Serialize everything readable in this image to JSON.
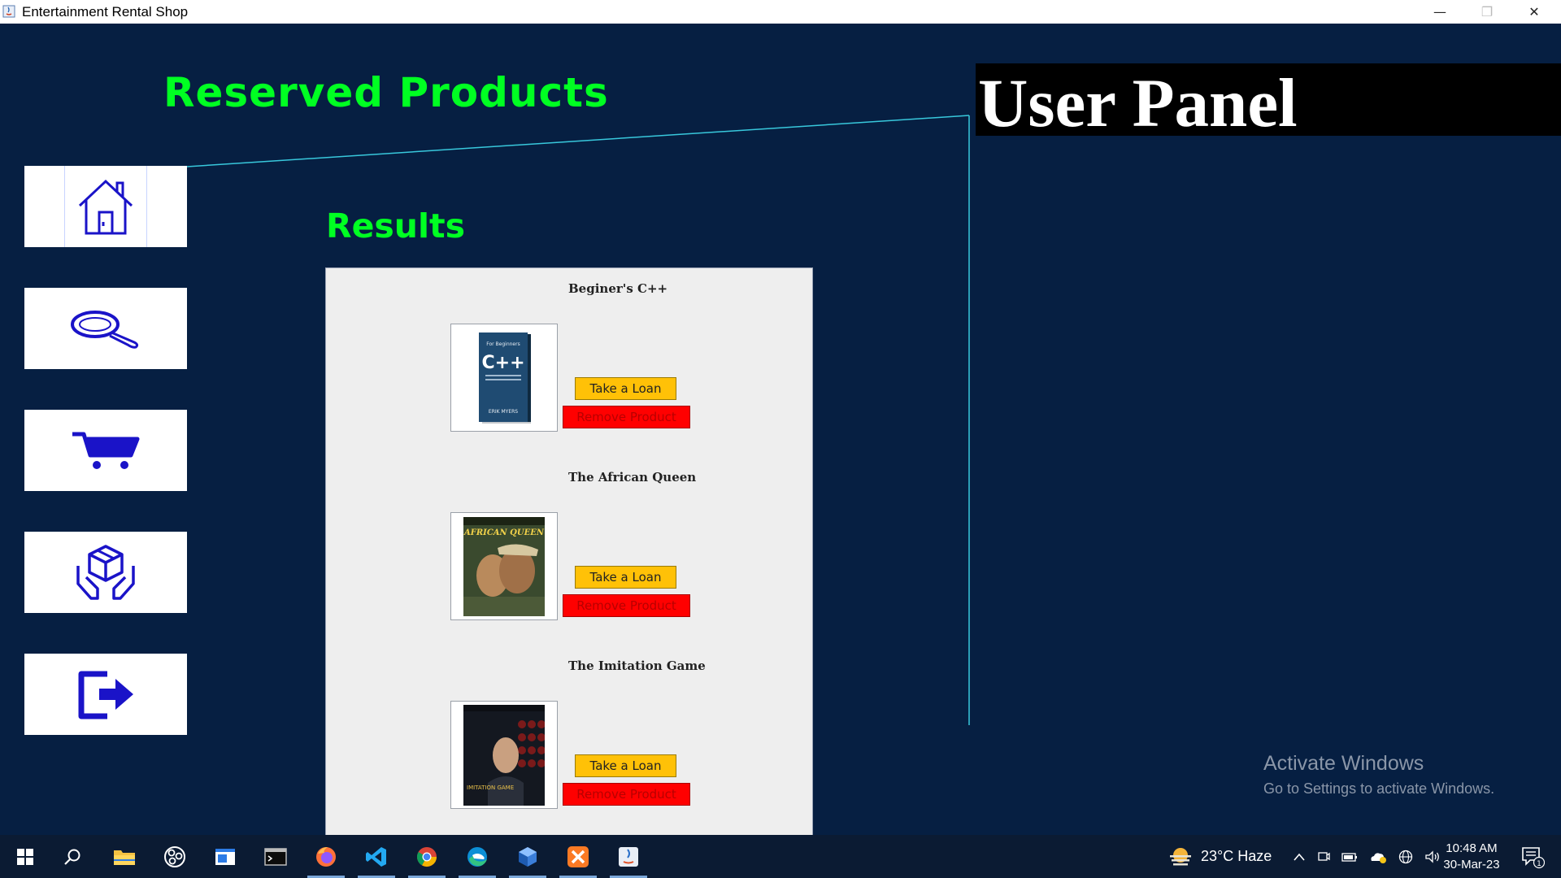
{
  "window": {
    "title": "Entertainment Rental Shop",
    "controls": [
      "minimize",
      "maximize",
      "close"
    ]
  },
  "header": {
    "page_title": "Reserved Products",
    "panel_title": "User Panel",
    "results_title": "Results"
  },
  "sidebar": {
    "items": [
      {
        "name": "home",
        "icon": "home-icon"
      },
      {
        "name": "search",
        "icon": "search-icon"
      },
      {
        "name": "cart",
        "icon": "cart-icon"
      },
      {
        "name": "products",
        "icon": "box-hands-icon"
      },
      {
        "name": "logout",
        "icon": "logout-icon"
      }
    ]
  },
  "products": [
    {
      "title": "Beginer's C++",
      "cover": "book-cover-cpp",
      "loan_label": "Take a Loan",
      "remove_label": "Remove Product"
    },
    {
      "title": "The African Queen",
      "cover": "movie-poster-african-queen",
      "loan_label": "Take a Loan",
      "remove_label": "Remove Product"
    },
    {
      "title": "The Imitation Game",
      "cover": "movie-poster-imitation-game",
      "loan_label": "Take a Loan",
      "remove_label": "Remove Product"
    }
  ],
  "covers": {
    "cpp_small": "For Beginners",
    "cpp_big": "C++",
    "cpp_author": "ERIK MYERS",
    "aq_title": "AFRICAN QUEEN",
    "ig_title": "IMITATION GAME"
  },
  "watermark": {
    "line1": "Activate Windows",
    "line2": "Go to Settings to activate Windows."
  },
  "taskbar": {
    "weather": "23°C  Haze",
    "time": "10:48 AM",
    "date": "30-Mar-23",
    "notification_count": "1"
  },
  "colors": {
    "background": "#061f42",
    "title_green": "#00ff22",
    "loan_button": "#ffc107",
    "remove_button": "#ff0000",
    "icon_blue": "#1a13c8"
  }
}
